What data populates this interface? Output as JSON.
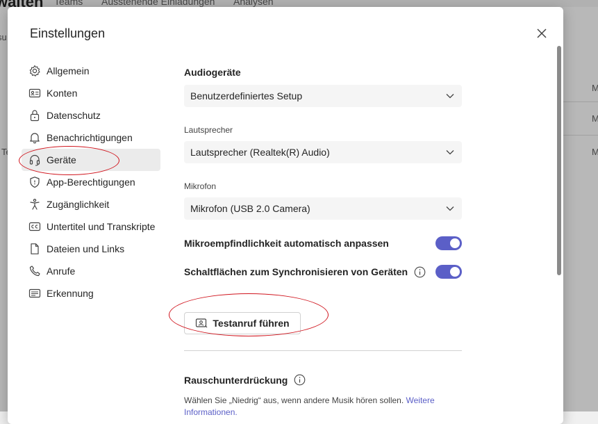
{
  "background": {
    "title": "waiten",
    "tabs": [
      "Teams",
      "Ausstehende Einladungen",
      "Analysen"
    ],
    "row_snippets": [
      "su",
      "Te",
      "M",
      "M",
      "M"
    ]
  },
  "dialog": {
    "title": "Einstellungen",
    "close_icon": "close-icon"
  },
  "nav": {
    "items": [
      {
        "label": "Allgemein",
        "icon": "gear-icon"
      },
      {
        "label": "Konten",
        "icon": "id-card-icon"
      },
      {
        "label": "Datenschutz",
        "icon": "lock-icon"
      },
      {
        "label": "Benachrichtigungen",
        "icon": "bell-icon"
      },
      {
        "label": "Geräte",
        "icon": "headset-icon",
        "active": true
      },
      {
        "label": "App-Berechtigungen",
        "icon": "shield-icon"
      },
      {
        "label": "Zugänglichkeit",
        "icon": "accessibility-icon"
      },
      {
        "label": "Untertitel und Transkripte",
        "icon": "cc-icon"
      },
      {
        "label": "Dateien und Links",
        "icon": "file-icon"
      },
      {
        "label": "Anrufe",
        "icon": "phone-icon"
      },
      {
        "label": "Erkennung",
        "icon": "text-recognition-icon"
      }
    ]
  },
  "content": {
    "audio_title": "Audiogeräte",
    "audio_select": "Benutzerdefiniertes Setup",
    "speaker_label": "Lautsprecher",
    "speaker_select": "Lautsprecher (Realtek(R) Audio)",
    "mic_label": "Mikrofon",
    "mic_select": "Mikrofon (USB 2.0 Camera)",
    "toggle_mic_auto": {
      "label": "Mikroempfindlichkeit automatisch anpassen",
      "on": true
    },
    "toggle_sync": {
      "label": "Schaltflächen zum Synchronisieren von Geräten",
      "on": true
    },
    "test_call_button": "Testanruf führen",
    "noise_title": "Rauschunterdrückung",
    "noise_desc": "Wählen Sie „Niedrig“ aus, wenn andere Musik hören sollen.",
    "noise_link": "Weitere Informationen."
  },
  "colors": {
    "accent": "#5b5fc7",
    "annotation": "#d0141d"
  }
}
